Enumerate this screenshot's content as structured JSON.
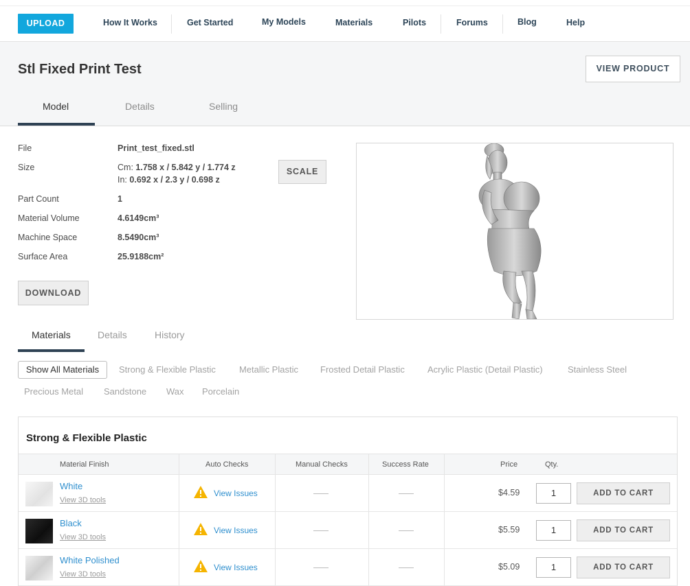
{
  "nav": {
    "upload_label": "UPLOAD",
    "links": [
      "How It Works",
      "Get Started",
      "My Models",
      "Materials",
      "Pilots",
      "Forums",
      "Blog",
      "Help"
    ]
  },
  "header": {
    "title": "Stl Fixed Print Test",
    "view_product_label": "VIEW PRODUCT",
    "tabs": [
      "Model",
      "Details",
      "Selling"
    ],
    "active_tab": "Model"
  },
  "model_info": {
    "file_label": "File",
    "file_value": "Print_test_fixed.stl",
    "size_label": "Size",
    "size_cm_prefix": "Cm:",
    "size_cm": "1.758 x / 5.842 y / 1.774 z",
    "size_in_prefix": "In:",
    "size_in": "0.692 x / 2.3 y / 0.698 z",
    "part_count_label": "Part Count",
    "part_count": "1",
    "material_volume_label": "Material Volume",
    "material_volume": "4.6149cm³",
    "machine_space_label": "Machine Space",
    "machine_space": "8.5490cm³",
    "surface_area_label": "Surface Area",
    "surface_area": "25.9188cm²",
    "scale_label": "SCALE",
    "download_label": "DOWNLOAD"
  },
  "materials_tabs": [
    "Materials",
    "Details",
    "History"
  ],
  "materials_active_tab": "Materials",
  "filters": {
    "active": "Show All Materials",
    "items": [
      "Strong & Flexible Plastic",
      "Metallic Plastic",
      "Frosted Detail Plastic",
      "Acrylic Plastic (Detail Plastic)",
      "Stainless Steel",
      "Precious Metal",
      "Sandstone",
      "Wax",
      "Porcelain"
    ]
  },
  "material_section": {
    "title": "Strong & Flexible Plastic",
    "columns": [
      "Material Finish",
      "Auto Checks",
      "Manual Checks",
      "Success Rate",
      "Price",
      "Qty."
    ],
    "rows": [
      {
        "name": "White",
        "tools": "View 3D tools",
        "issues": "View Issues",
        "price": "$4.59",
        "qty": "1",
        "cart": "ADD TO CART",
        "swatch_color": "#f1f1f1"
      },
      {
        "name": "Black",
        "tools": "View 3D tools",
        "issues": "View Issues",
        "price": "$5.59",
        "qty": "1",
        "cart": "ADD TO CART",
        "swatch_color": "#1e1e1e"
      },
      {
        "name": "White Polished",
        "tools": "View 3D tools",
        "issues": "View Issues",
        "price": "$5.09",
        "qty": "1",
        "cart": "ADD TO CART",
        "swatch_color": "#e6e6e6"
      }
    ]
  },
  "colors": {
    "accent": "#12a7dd",
    "nav_text": "#2d4558",
    "link": "#2f8fce",
    "warning": "#f5b400"
  }
}
